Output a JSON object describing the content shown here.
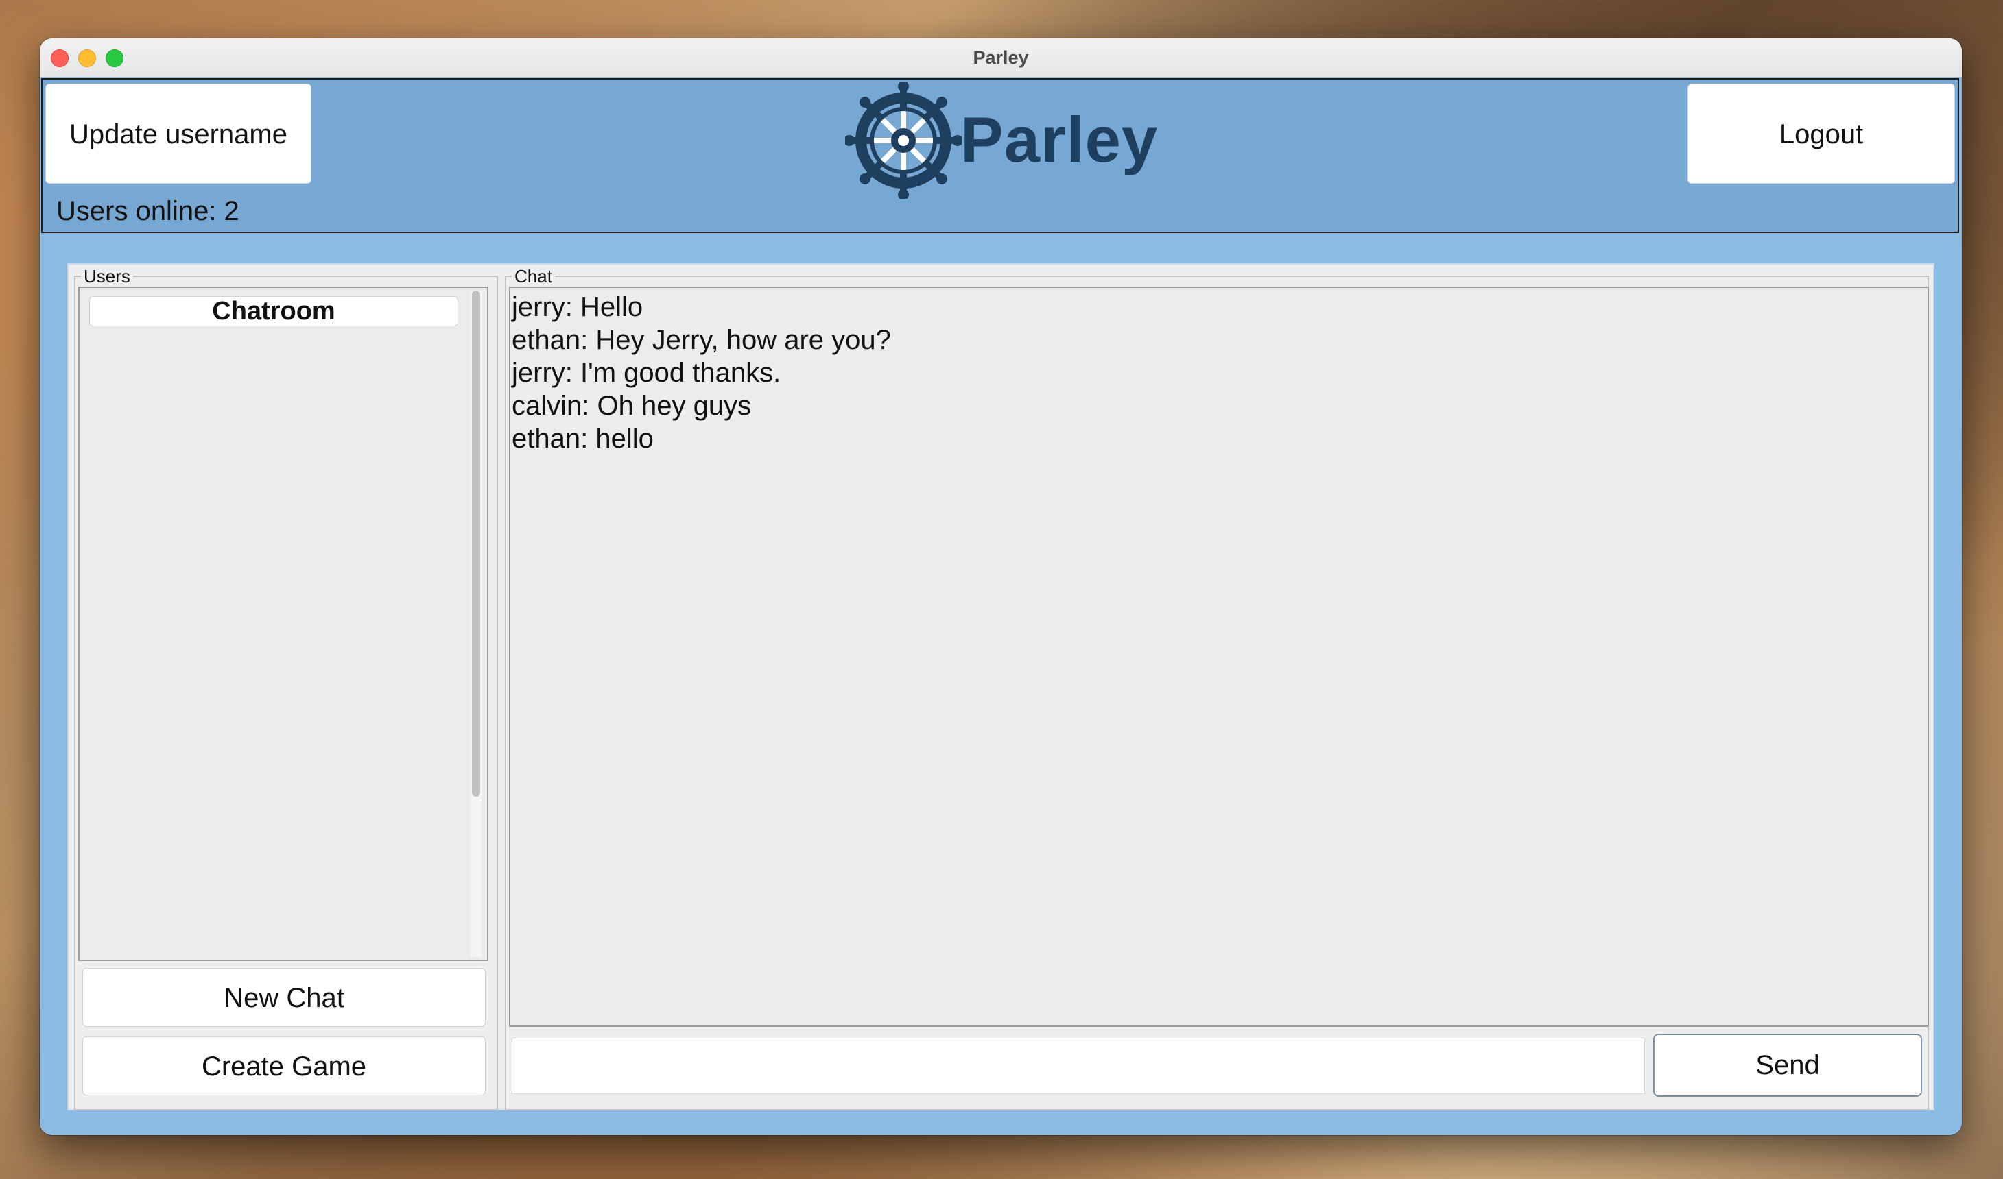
{
  "window": {
    "title": "Parley"
  },
  "header": {
    "update_label": "Update username",
    "logout_label": "Logout",
    "online_text": "Users online: 2",
    "logo_text": "Parley"
  },
  "users_panel": {
    "title": "Users",
    "items": [
      {
        "label": "Chatroom"
      }
    ],
    "new_chat_label": "New Chat",
    "create_game_label": "Create Game"
  },
  "chat_panel": {
    "title": "Chat",
    "messages": [
      "jerry: Hello",
      "ethan: Hey Jerry, how are you?",
      "jerry: I'm good thanks.",
      "calvin: Oh hey guys",
      "ethan: hello"
    ],
    "input_value": "",
    "send_label": "Send"
  },
  "colors": {
    "header_bg": "#77a8d3",
    "window_bg": "#8bbbe3",
    "logo_color": "#1f3f5f"
  },
  "icons": {
    "logo": "ship-wheel-icon"
  }
}
